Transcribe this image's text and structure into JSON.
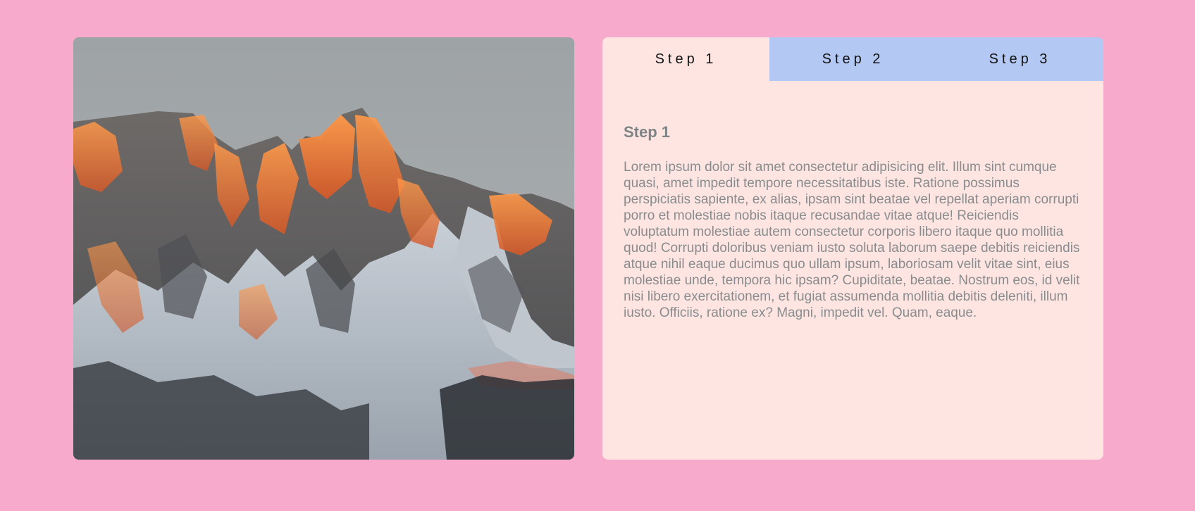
{
  "image": {
    "alt": "Snowy mountain peaks at sunset"
  },
  "tabs": [
    {
      "label": "Step 1",
      "active": true
    },
    {
      "label": "Step 2",
      "active": false
    },
    {
      "label": "Step 3",
      "active": false
    }
  ],
  "content": {
    "title": "Step 1",
    "body": "Lorem ipsum dolor sit amet consectetur adipisicing elit. Illum sint cumque quasi, amet impedit tempore necessitatibus iste. Ratione possimus perspiciatis sapiente, ex alias, ipsam sint beatae vel repellat aperiam corrupti porro et molestiae nobis itaque recusandae vitae atque! Reiciendis voluptatum molestiae autem consectetur corporis libero itaque quo mollitia quod! Corrupti doloribus veniam iusto soluta laborum saepe debitis reiciendis atque nihil eaque ducimus quo ullam ipsum, laboriosam velit vitae sint, eius molestiae unde, tempora hic ipsam? Cupiditate, beatae. Nostrum eos, id velit nisi libero exercitationem, et fugiat assumenda mollitia debitis deleniti, illum iusto. Officiis, ratione ex? Magni, impedit vel. Quam, eaque."
  },
  "colors": {
    "page_background": "#f7aacb",
    "panel_background": "#ffe5e2",
    "tab_inactive": "#b3c8f2",
    "heading": "#7e8486",
    "body_text": "#888c8e"
  }
}
